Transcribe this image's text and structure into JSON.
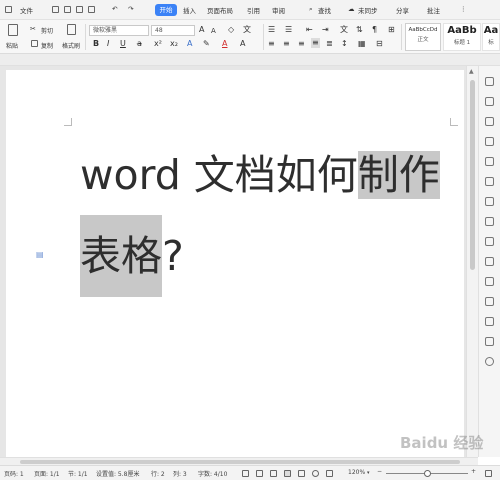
{
  "menu": {
    "file": "文件",
    "tabs": [
      "开始",
      "插入",
      "页面布局",
      "引用",
      "审阅"
    ],
    "search": "查找",
    "sync": "未同步",
    "share": "分享",
    "annotate": "批注"
  },
  "ribbon": {
    "paste": "粘贴",
    "cut": "剪切",
    "copy": "复制",
    "format_painter": "格式刷",
    "font_name": "微软雅黑",
    "font_size": "48",
    "bold": "B",
    "italic": "I",
    "underline": "U",
    "font_color_glyph": "A",
    "styles": [
      {
        "sample": "AaBbCcDd",
        "name": "正文"
      },
      {
        "sample": "AaBb",
        "name": "标题 1"
      },
      {
        "sample": "Aa",
        "name": "标"
      }
    ]
  },
  "document": {
    "line1_normal": "word 文档如何",
    "line1_highlight": "制作",
    "line2_highlight": "表格",
    "line2_normal": "?"
  },
  "status": {
    "page": "页码: 1",
    "pages": "页面: 1/1",
    "section": "节: 1/1",
    "position": "设置值: 5.8厘米",
    "row": "行: 2",
    "col": "列: 3",
    "words": "字数: 4/10",
    "zoom": "120%"
  },
  "watermark": "Baidu 经验"
}
